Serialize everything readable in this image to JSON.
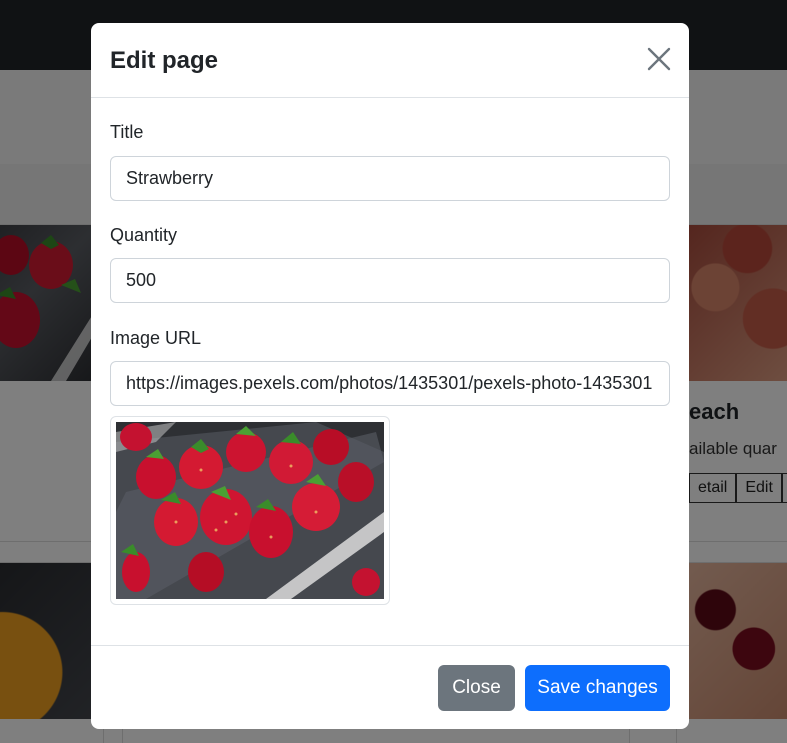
{
  "background": {
    "right_card": {
      "title": "each",
      "text": "ailable quar",
      "buttons": [
        "etail",
        "Edit"
      ]
    }
  },
  "modal": {
    "title": "Edit page",
    "close_icon": "close-icon",
    "fields": {
      "title": {
        "label": "Title",
        "value": "Strawberry"
      },
      "quantity": {
        "label": "Quantity",
        "value": "500"
      },
      "image_url": {
        "label": "Image URL",
        "value": "https://images.pexels.com/photos/1435301/pexels-photo-1435301"
      }
    },
    "footer": {
      "close_label": "Close",
      "save_label": "Save changes"
    }
  },
  "colors": {
    "primary": "#0d6efd",
    "secondary": "#6c757d",
    "navbar": "#212529"
  }
}
